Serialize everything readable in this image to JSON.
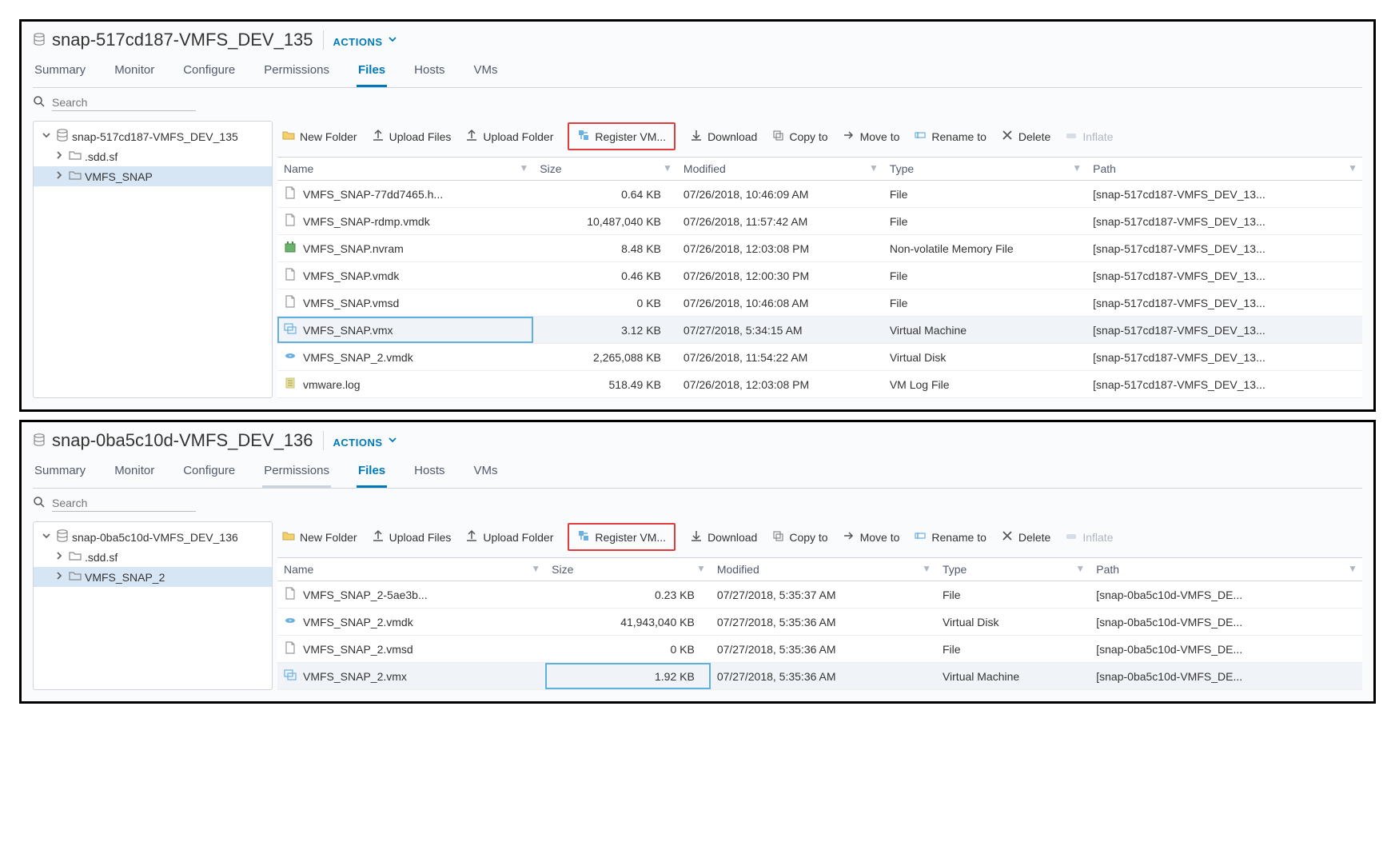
{
  "panels": [
    {
      "title": "snap-517cd187-VMFS_DEV_135",
      "actions": "ACTIONS",
      "tabs": [
        "Summary",
        "Monitor",
        "Configure",
        "Permissions",
        "Files",
        "Hosts",
        "VMs"
      ],
      "activeTab": "Files",
      "searchPlaceholder": "Search",
      "tree": {
        "root": "snap-517cd187-VMFS_DEV_135",
        "children": [
          ".sdd.sf",
          "VMFS_SNAP"
        ],
        "selected": "VMFS_SNAP"
      },
      "toolbar": [
        "New Folder",
        "Upload Files",
        "Upload Folder",
        "Register VM...",
        "Download",
        "Copy to",
        "Move to",
        "Rename to",
        "Delete",
        "Inflate"
      ],
      "columns": [
        "Name",
        "Size",
        "Modified",
        "Type",
        "Path"
      ],
      "rows": [
        {
          "icon": "file",
          "name": "VMFS_SNAP-77dd7465.h...",
          "size": "0.64 KB",
          "modified": "07/26/2018, 10:46:09 AM",
          "type": "File",
          "path": "[snap-517cd187-VMFS_DEV_13..."
        },
        {
          "icon": "file",
          "name": "VMFS_SNAP-rdmp.vmdk",
          "size": "10,487,040 KB",
          "modified": "07/26/2018, 11:57:42 AM",
          "type": "File",
          "path": "[snap-517cd187-VMFS_DEV_13..."
        },
        {
          "icon": "nvram",
          "name": "VMFS_SNAP.nvram",
          "size": "8.48 KB",
          "modified": "07/26/2018, 12:03:08 PM",
          "type": "Non-volatile Memory File",
          "path": "[snap-517cd187-VMFS_DEV_13..."
        },
        {
          "icon": "file",
          "name": "VMFS_SNAP.vmdk",
          "size": "0.46 KB",
          "modified": "07/26/2018, 12:00:30 PM",
          "type": "File",
          "path": "[snap-517cd187-VMFS_DEV_13..."
        },
        {
          "icon": "file",
          "name": "VMFS_SNAP.vmsd",
          "size": "0 KB",
          "modified": "07/26/2018, 10:46:08 AM",
          "type": "File",
          "path": "[snap-517cd187-VMFS_DEV_13..."
        },
        {
          "icon": "vmx",
          "name": "VMFS_SNAP.vmx",
          "size": "3.12 KB",
          "modified": "07/27/2018, 5:34:15 AM",
          "type": "Virtual Machine",
          "path": "[snap-517cd187-VMFS_DEV_13...",
          "selected": true,
          "boxcell": "first"
        },
        {
          "icon": "vmdk",
          "name": "VMFS_SNAP_2.vmdk",
          "size": "2,265,088 KB",
          "modified": "07/26/2018, 11:54:22 AM",
          "type": "Virtual Disk",
          "path": "[snap-517cd187-VMFS_DEV_13..."
        },
        {
          "icon": "log",
          "name": "vmware.log",
          "size": "518.49 KB",
          "modified": "07/26/2018, 12:03:08 PM",
          "type": "VM Log File",
          "path": "[snap-517cd187-VMFS_DEV_13..."
        }
      ]
    },
    {
      "title": "snap-0ba5c10d-VMFS_DEV_136",
      "actions": "ACTIONS",
      "tabs": [
        "Summary",
        "Monitor",
        "Configure",
        "Permissions",
        "Files",
        "Hosts",
        "VMs"
      ],
      "activeTab": "Files",
      "subTab": "Permissions",
      "searchPlaceholder": "Search",
      "tree": {
        "root": "snap-0ba5c10d-VMFS_DEV_136",
        "children": [
          ".sdd.sf",
          "VMFS_SNAP_2"
        ],
        "selected": "VMFS_SNAP_2"
      },
      "toolbar": [
        "New Folder",
        "Upload Files",
        "Upload Folder",
        "Register VM...",
        "Download",
        "Copy to",
        "Move to",
        "Rename to",
        "Delete",
        "Inflate"
      ],
      "columns": [
        "Name",
        "Size",
        "Modified",
        "Type",
        "Path"
      ],
      "rows": [
        {
          "icon": "file",
          "name": "VMFS_SNAP_2-5ae3b...",
          "size": "0.23 KB",
          "modified": "07/27/2018, 5:35:37 AM",
          "type": "File",
          "path": "[snap-0ba5c10d-VMFS_DE..."
        },
        {
          "icon": "vmdk",
          "name": "VMFS_SNAP_2.vmdk",
          "size": "41,943,040 KB",
          "modified": "07/27/2018, 5:35:36 AM",
          "type": "Virtual Disk",
          "path": "[snap-0ba5c10d-VMFS_DE..."
        },
        {
          "icon": "file",
          "name": "VMFS_SNAP_2.vmsd",
          "size": "0 KB",
          "modified": "07/27/2018, 5:35:36 AM",
          "type": "File",
          "path": "[snap-0ba5c10d-VMFS_DE..."
        },
        {
          "icon": "vmx",
          "name": "VMFS_SNAP_2.vmx",
          "size": "1.92 KB",
          "modified": "07/27/2018, 5:35:36 AM",
          "type": "Virtual Machine",
          "path": "[snap-0ba5c10d-VMFS_DE...",
          "selected": true,
          "boxcell": "size"
        }
      ]
    }
  ]
}
